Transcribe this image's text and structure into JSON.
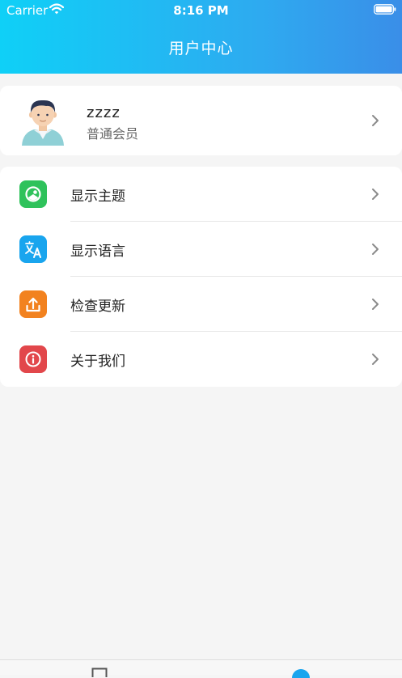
{
  "status_bar": {
    "carrier": "Carrier",
    "time": "8:16 PM"
  },
  "header": {
    "title": "用户中心",
    "gradient": [
      "#0fd0f7",
      "#3a8ee8"
    ]
  },
  "profile": {
    "name": "zzzz",
    "role": "普通会员"
  },
  "menu": {
    "items": [
      {
        "label": "显示主题",
        "icon": "theme-icon",
        "color": "#2fc25b"
      },
      {
        "label": "显示语言",
        "icon": "translate-icon",
        "color": "#19a5ee"
      },
      {
        "label": "检查更新",
        "icon": "upload-icon",
        "color": "#f2821f"
      },
      {
        "label": "关于我们",
        "icon": "info-icon",
        "color": "#e2474b"
      }
    ]
  },
  "tab_bar": {
    "active_color": "#19a5ee"
  }
}
